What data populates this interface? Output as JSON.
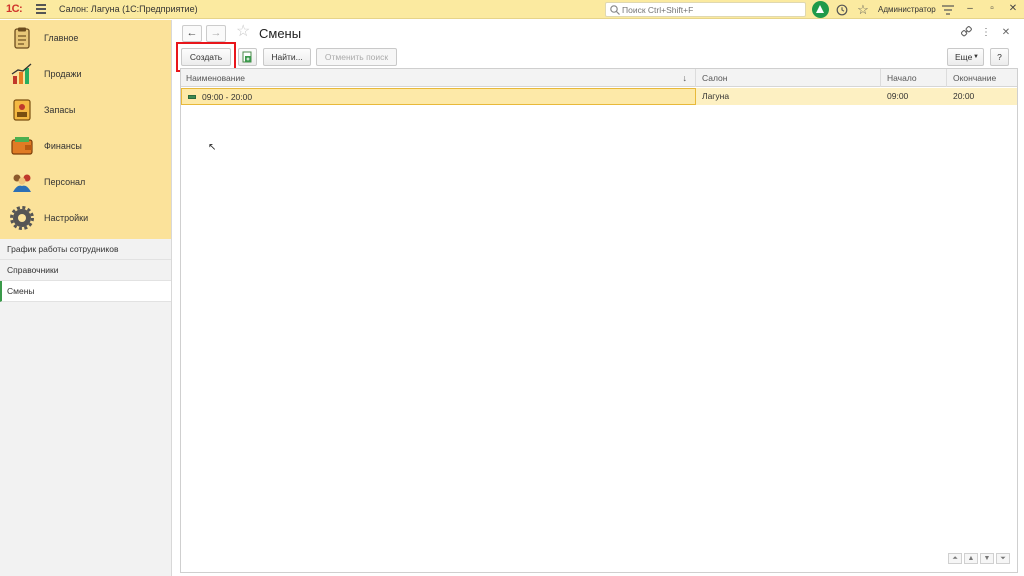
{
  "app": {
    "logo_text": "1С:",
    "title": "Салон: Лагуна  (1С:Предприятие)",
    "search_placeholder": "Поиск Ctrl+Shift+F",
    "user": "Администратор",
    "accent_color": "#fbe29a",
    "brand_color": "#d0342c"
  },
  "sidebar": {
    "sections": [
      {
        "label": "Главное",
        "icon": "clipboard-icon"
      },
      {
        "label": "Продажи",
        "icon": "sales-chart-icon"
      },
      {
        "label": "Запасы",
        "icon": "stock-icon"
      },
      {
        "label": "Финансы",
        "icon": "wallet-icon"
      },
      {
        "label": "Персонал",
        "icon": "staff-icon"
      },
      {
        "label": "Настройки",
        "icon": "gear-icon"
      }
    ],
    "subitems": [
      {
        "label": "График работы сотрудников"
      },
      {
        "label": "Справочники"
      },
      {
        "label": "Смены"
      }
    ]
  },
  "page": {
    "title": "Смены",
    "buttons": {
      "create": "Создать",
      "find": "Найти...",
      "cancel_search": "Отменить поиск",
      "more": "Еще",
      "help": "?"
    }
  },
  "table": {
    "columns": [
      "Наименование",
      "Салон",
      "Начало",
      "Окончание"
    ],
    "rows": [
      {
        "name": "09:00 - 20:00",
        "salon": "Лагуна",
        "start": "09:00",
        "end": "20:00"
      }
    ]
  }
}
